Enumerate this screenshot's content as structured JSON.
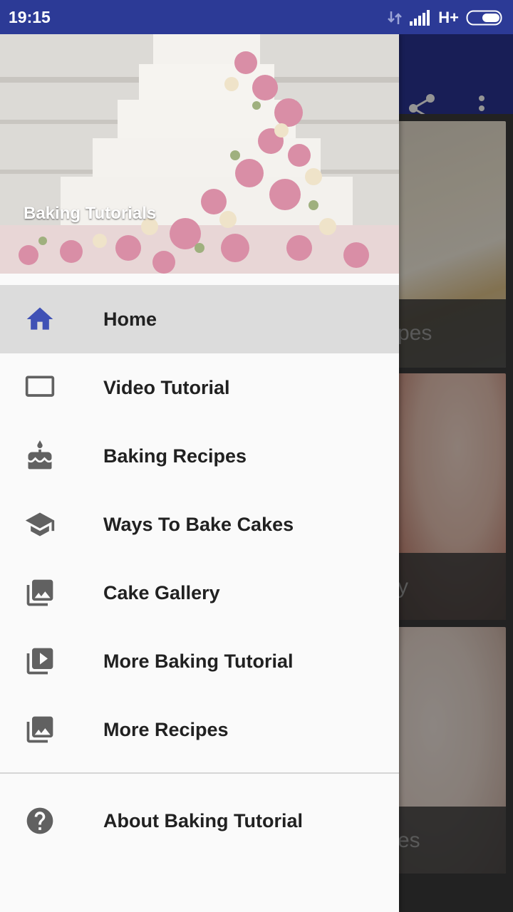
{
  "status_bar": {
    "time": "19:15",
    "network": "H+"
  },
  "drawer": {
    "header_title": "Baking Tutorials",
    "items": [
      {
        "label": "Home",
        "icon": "home-icon",
        "active": true
      },
      {
        "label": "Video Tutorial",
        "icon": "tv-icon"
      },
      {
        "label": "Baking Recipes",
        "icon": "cake-icon"
      },
      {
        "label": "Ways To Bake Cakes",
        "icon": "school-icon"
      },
      {
        "label": "Cake Gallery",
        "icon": "photo-library-icon"
      },
      {
        "label": "More Baking Tutorial",
        "icon": "video-library-icon"
      },
      {
        "label": "More Recipes",
        "icon": "photo-library-icon"
      }
    ],
    "secondary_items": [
      {
        "label": "About Baking Tutorial",
        "icon": "help-icon"
      }
    ]
  },
  "background_cards": [
    {
      "label_fragment": "pes"
    },
    {
      "label_fragment": "y"
    },
    {
      "label_fragment": "es"
    }
  ],
  "colors": {
    "primary": "#2a3594",
    "status_bar": "#2c3a96",
    "active_icon": "#3f51b5",
    "icon_grey": "#616161"
  }
}
